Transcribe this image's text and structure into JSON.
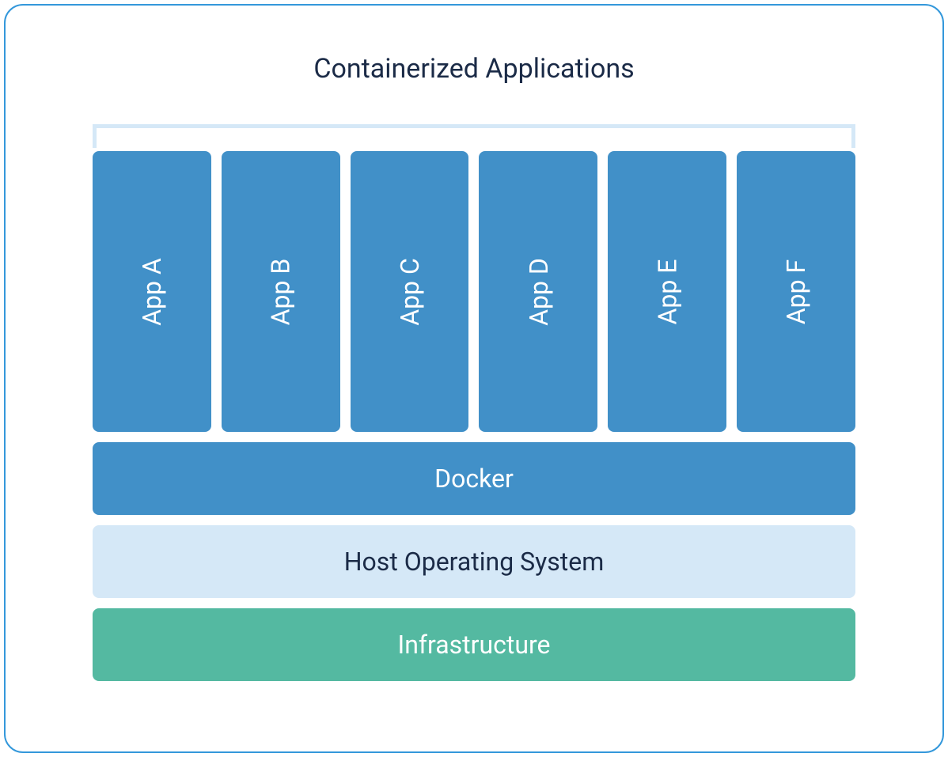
{
  "title": "Containerized Applications",
  "apps": [
    {
      "label": "App A"
    },
    {
      "label": "App B"
    },
    {
      "label": "App C"
    },
    {
      "label": "App D"
    },
    {
      "label": "App E"
    },
    {
      "label": "App F"
    }
  ],
  "layers": {
    "docker": "Docker",
    "host": "Host Operating System",
    "infrastructure": "Infrastructure"
  }
}
